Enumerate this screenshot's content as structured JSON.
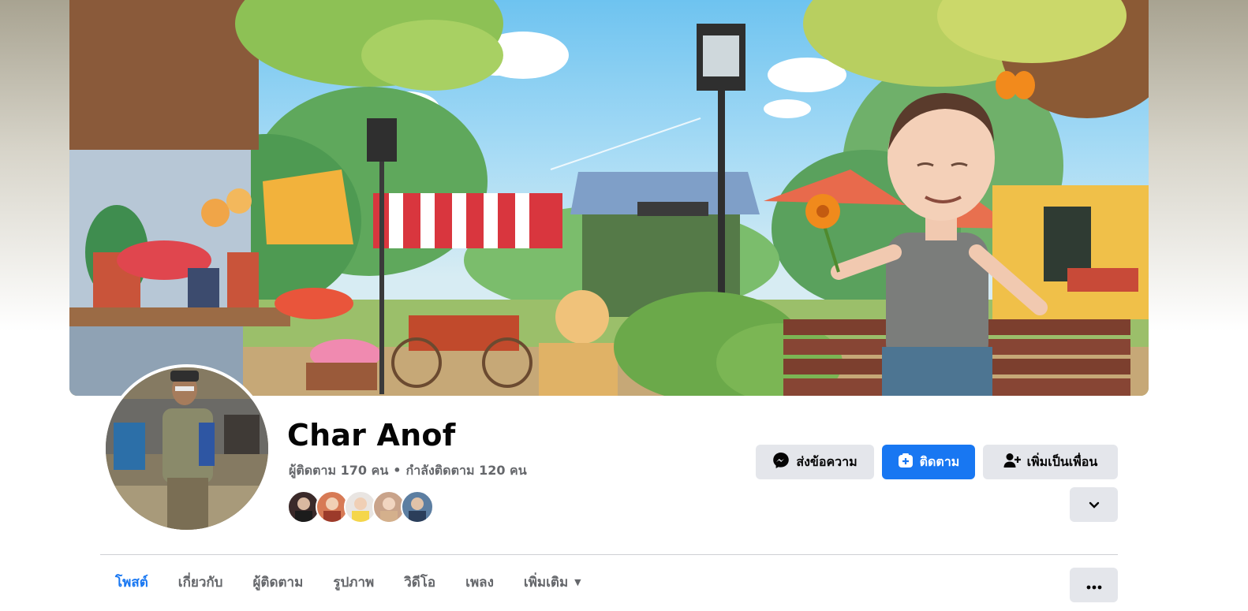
{
  "profile": {
    "name": "Char Anof",
    "followers_text": "ผู้ติดตาม 170 คน",
    "separator": "•",
    "following_text": "กำลังติดตาม 120 คน",
    "friend_avatars": [
      "friend-1",
      "friend-2",
      "friend-3",
      "friend-4",
      "friend-5"
    ]
  },
  "actions": {
    "message_label": "ส่งข้อความ",
    "follow_label": "ติดตาม",
    "add_friend_label": "เพิ่มเป็นเพื่อน",
    "more_icon": "chevron-down-icon"
  },
  "tabs": [
    {
      "label": "โพสต์",
      "active": true
    },
    {
      "label": "เกี่ยวกับ"
    },
    {
      "label": "ผู้ติดตาม"
    },
    {
      "label": "รูปภาพ"
    },
    {
      "label": "วิดีโอ"
    },
    {
      "label": "เพลง"
    },
    {
      "label": "เพิ่มเติม",
      "caret": "▼"
    }
  ],
  "tab_more_icon": "ellipsis-icon",
  "colors": {
    "accent": "#1877f2",
    "button_gray": "#e4e6eb",
    "muted_text": "#65676b"
  }
}
